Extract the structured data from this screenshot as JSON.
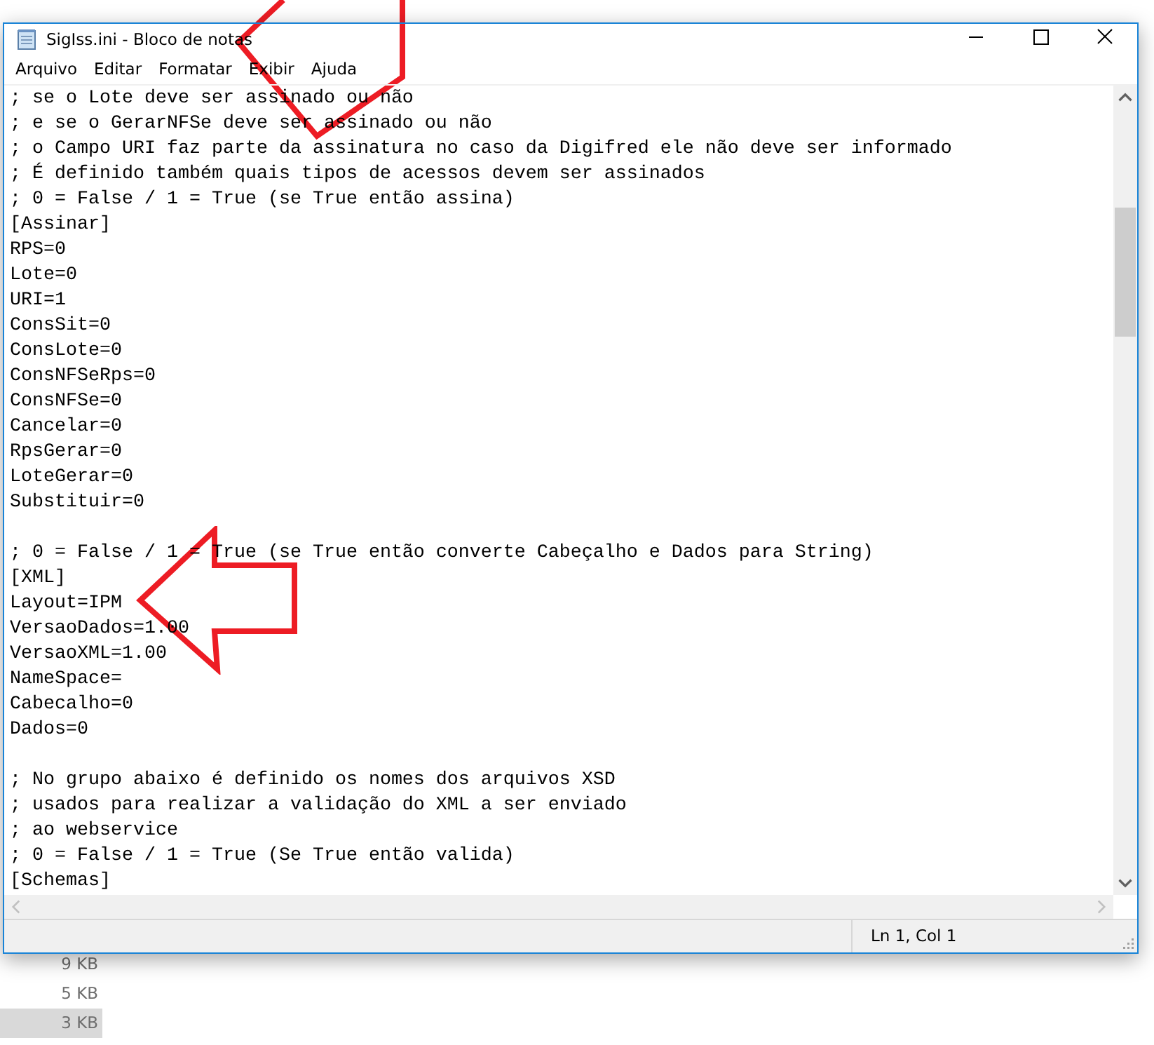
{
  "window": {
    "title": "SigIss.ini - Bloco de notas"
  },
  "menu": [
    "Arquivo",
    "Editar",
    "Formatar",
    "Exibir",
    "Ajuda"
  ],
  "editor": {
    "blocks": [
      [
        "; se o Lote deve ser assinado ou não",
        "; e se o GerarNFSe deve ser assinado ou não",
        "; o Campo URI faz parte da assinatura no caso da Digifred ele não deve ser informado",
        "; É definido também quais tipos de acessos devem ser assinados",
        "; 0 = False / 1 = True (se True então assina)",
        "[Assinar]",
        "RPS=0",
        "Lote=0",
        "URI=1",
        "ConsSit=0",
        "ConsLote=0",
        "ConsNFSeRps=0",
        "ConsNFSe=0",
        "Cancelar=0",
        "RpsGerar=0",
        "LoteGerar=0",
        "Substituir=0"
      ],
      [
        "; 0 = False / 1 = True (se True então converte Cabeçalho e Dados para String)",
        "[XML]",
        "Layout=IPM",
        "VersaoDados=1.00",
        "VersaoXML=1.00",
        "NameSpace=",
        "Cabecalho=0",
        "Dados=0"
      ],
      [
        "; No grupo abaixo é definido os nomes dos arquivos XSD",
        "; usados para realizar a validação do XML a ser enviado",
        "; ao webservice",
        "; 0 = False / 1 = True (Se True então valida)",
        "[Schemas]"
      ]
    ]
  },
  "status_bar": {
    "position": "Ln 1, Col 1"
  },
  "background_files": [
    {
      "size": "9 KB",
      "selected": false
    },
    {
      "size": "5 KB",
      "selected": false
    },
    {
      "size": "3 KB",
      "selected": true
    }
  ]
}
